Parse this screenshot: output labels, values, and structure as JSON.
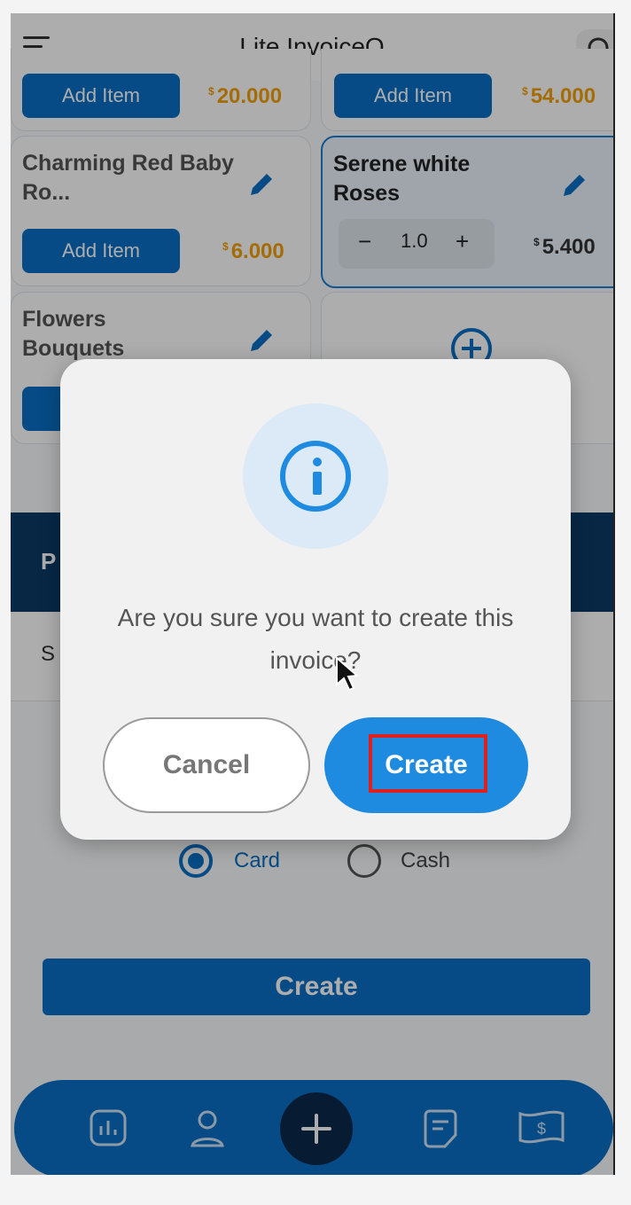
{
  "app": {
    "title": "Lite InvoiceQ"
  },
  "products": [
    {
      "add_label": "Add Item",
      "price_currency": "$",
      "price": "20.000"
    },
    {
      "add_label": "Add Item",
      "price_currency": "$",
      "price": "54.000"
    },
    {
      "name": "Charming Red Baby Ro...",
      "add_label": "Add Item",
      "price_currency": "$",
      "price": "6.000"
    },
    {
      "name": "Serene white Roses",
      "qty_minus": "−",
      "qty_value": "1.0",
      "qty_plus": "+",
      "price_currency": "$",
      "price": "5.400",
      "selected": true
    },
    {
      "name": "Flowers Bouquets"
    }
  ],
  "payment": {
    "options": [
      {
        "label": "Card",
        "selected": true
      },
      {
        "label": "Cash",
        "selected": false
      }
    ]
  },
  "create_button_label": "Create",
  "bottom_nav": {
    "icons": [
      "chart-icon",
      "user-icon",
      "plus-icon",
      "invoice-icon",
      "money-icon"
    ]
  },
  "dialog": {
    "icon": "info-icon",
    "message": "Are you sure you want to create this invoice?",
    "cancel_label": "Cancel",
    "confirm_label": "Create"
  },
  "colors": {
    "primary": "#0a6fc4",
    "dialog_accent": "#1e8ae0",
    "price": "#f2a007",
    "highlight": "#e01f1f"
  }
}
